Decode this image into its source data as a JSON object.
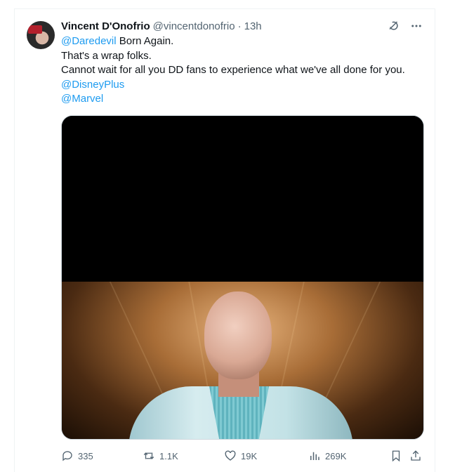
{
  "tweet": {
    "author_name": "Vincent D'Onofrio",
    "handle": "@vincentdonofrio",
    "separator": "·",
    "time": "13h",
    "icons": {
      "grok": "grok-icon",
      "more": "more-icon"
    },
    "text": {
      "mention1": "@Daredevil",
      "line1_rest": " Born Again.",
      "line2": "That's a wrap folks.",
      "line3": "Cannot wait for all you DD fans to experience what we've all done for you.",
      "mention2": "@DisneyPlus",
      "mention3": "@Marvel"
    },
    "actions": {
      "replies": "335",
      "reposts": "1.1K",
      "likes": "19K",
      "views": "269K"
    },
    "colors": {
      "link": "#1d9bf0",
      "muted": "#536471",
      "text": "#0f1419"
    }
  }
}
